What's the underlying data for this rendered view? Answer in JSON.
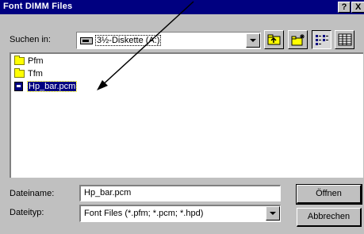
{
  "window": {
    "title": "Font DIMM Files",
    "help_glyph": "?",
    "close_glyph": "X"
  },
  "toolbar": {
    "look_in_label": "Suchen in:",
    "look_in_value": "3½-Diskette (A:)",
    "look_in_icon": "floppy-drive-icon",
    "buttons": [
      "up-folder-icon",
      "new-folder-icon",
      "list-view-icon",
      "details-view-icon"
    ]
  },
  "files": [
    {
      "name": "Pfm",
      "type": "folder",
      "icon": "folder-icon"
    },
    {
      "name": "Tfm",
      "type": "folder",
      "icon": "folder-icon"
    },
    {
      "name": "Hp_bar.pcm",
      "type": "file",
      "icon": "file-icon",
      "selected": true
    }
  ],
  "form": {
    "filename_label": "Dateiname:",
    "filename_value": "Hp_bar.pcm",
    "filetype_label": "Dateityp:",
    "filetype_value": "Font Files (*.pfm; *.pcm; *.hpd)"
  },
  "buttons": {
    "open": "Öffnen",
    "cancel": "Abbrechen"
  },
  "colors": {
    "title_bar": "#000080",
    "dialog_face": "#c0c0c0",
    "selection": "#000080",
    "folder": "#ffff00"
  }
}
